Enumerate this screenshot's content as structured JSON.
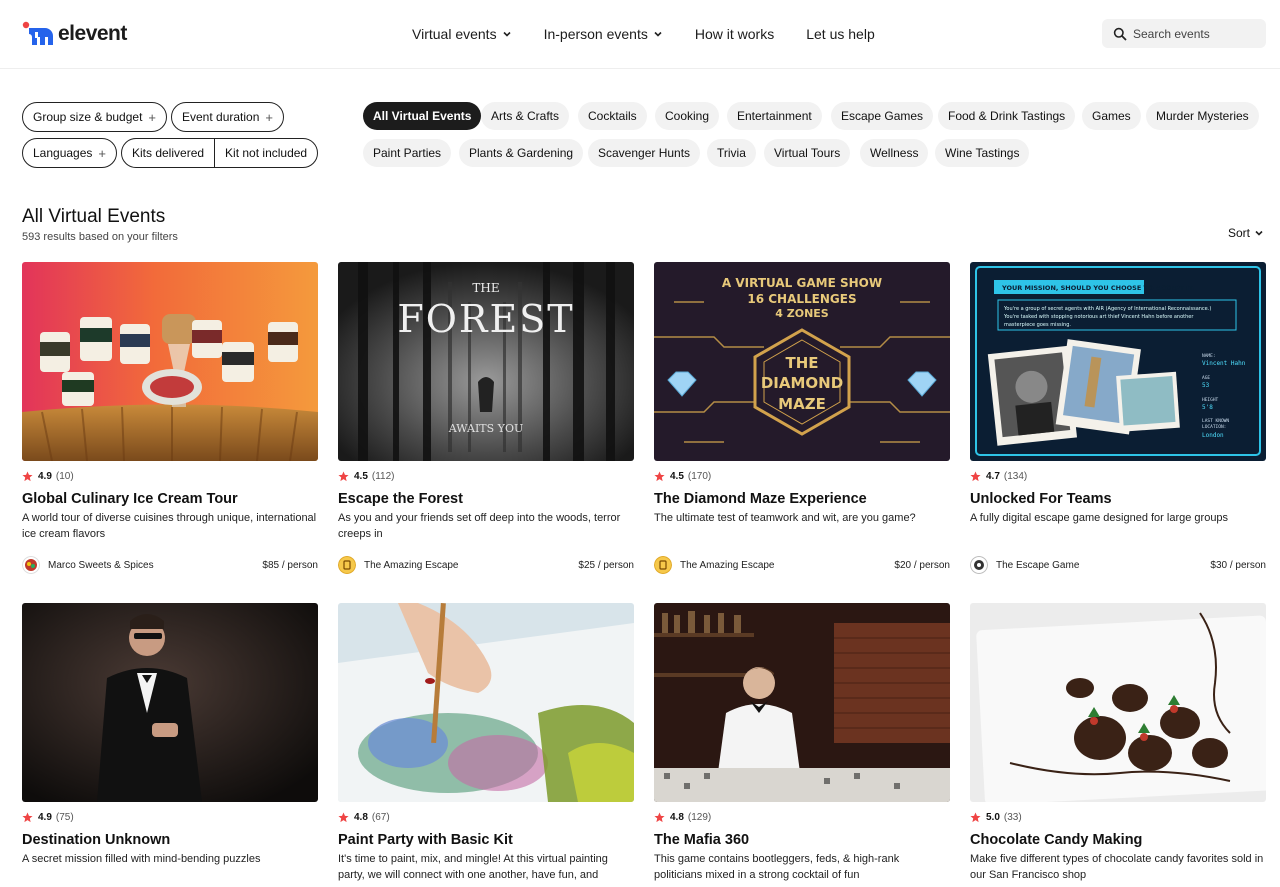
{
  "brand": {
    "name": "elevent",
    "accent": "#ef4444",
    "logo_blue": "#2563eb"
  },
  "nav": [
    {
      "label": "Virtual events",
      "dropdown": true
    },
    {
      "label": "In-person events",
      "dropdown": true
    },
    {
      "label": "How it works",
      "dropdown": false
    },
    {
      "label": "Let us help",
      "dropdown": false
    }
  ],
  "search": {
    "placeholder": "Search events"
  },
  "filters": {
    "group_size": "Group size & budget",
    "duration": "Event duration",
    "languages": "Languages",
    "kits_delivered": "Kits delivered",
    "kit_not_included": "Kit not included"
  },
  "categories": [
    "All Virtual Events",
    "Arts & Crafts",
    "Cocktails",
    "Cooking",
    "Entertainment",
    "Escape Games",
    "Food & Drink Tastings",
    "Games",
    "Murder Mysteries",
    "Paint Parties",
    "Plants & Gardening",
    "Scavenger Hunts",
    "Trivia",
    "Virtual Tours",
    "Wellness",
    "Wine Tastings"
  ],
  "active_category": "All Virtual Events",
  "results": {
    "title": "All Virtual Events",
    "count_text": "593 results based on your filters",
    "sort_label": "Sort"
  },
  "cards": [
    {
      "rating": "4.9",
      "count": "(10)",
      "title": "Global Culinary Ice Cream Tour",
      "desc": "A world tour of diverse cuisines through unique, international ice cream flavors",
      "host": "Marco Sweets & Spices",
      "price": "$85 / person"
    },
    {
      "rating": "4.5",
      "count": "(112)",
      "title": "Escape the Forest",
      "desc": "As you and your friends set off deep into the woods, terror creeps in",
      "host": "The Amazing Escape",
      "price": "$25 / person",
      "image_text": {
        "the": "THE",
        "title": "FOREST",
        "sub": "AWAITS YOU"
      }
    },
    {
      "rating": "4.5",
      "count": "(170)",
      "title": "The Diamond Maze Experience",
      "desc": "The ultimate test of teamwork and wit, are you game?",
      "host": "The Amazing Escape",
      "price": "$20 / person",
      "image_text": {
        "l1": "A VIRTUAL GAME SHOW",
        "l2": "16 CHALLENGES",
        "l3": "4 ZONES",
        "m1": "THE",
        "m2": "DIAMOND",
        "m3": "MAZE"
      }
    },
    {
      "rating": "4.7",
      "count": "(134)",
      "title": "Unlocked For Teams",
      "desc": "A fully digital escape game designed for large groups",
      "host": "The Escape Game",
      "price": "$30 / person",
      "image_text": {
        "banner": "YOUR MISSION, SHOULD YOU CHOOSE TO ACCEPT IT.",
        "p1": "You're a group of secret agents with AIR (Agency of International Reconnaissance.)",
        "p2": "You're tasked with stopping notorious art thief Vincent Hahn before another",
        "p3": "masterpiece goes missing.",
        "name_label": "NAME:",
        "name": "Vincent Hahn",
        "age_label": "AGE",
        "age": "53",
        "height_label": "HEIGHT",
        "height": "5'8",
        "loc_label1": "LAST KNOWN",
        "loc_label2": "LOCATION:",
        "loc": "London"
      }
    },
    {
      "rating": "4.9",
      "count": "(75)",
      "title": "Destination Unknown",
      "desc": "A secret mission filled with mind-bending puzzles"
    },
    {
      "rating": "4.8",
      "count": "(67)",
      "title": "Paint Party with Basic Kit",
      "desc": "It's time to paint, mix, and mingle! At this virtual painting party, we will connect with one another, have fun, and explore our creative sides"
    },
    {
      "rating": "4.8",
      "count": "(129)",
      "title": "The Mafia 360",
      "desc": "This game contains bootleggers, feds, & high-rank politicians mixed in a strong cocktail of fun"
    },
    {
      "rating": "5.0",
      "count": "(33)",
      "title": "Chocolate Candy Making",
      "desc": "Make five different types of chocolate candy favorites sold in our San Francisco shop"
    }
  ]
}
